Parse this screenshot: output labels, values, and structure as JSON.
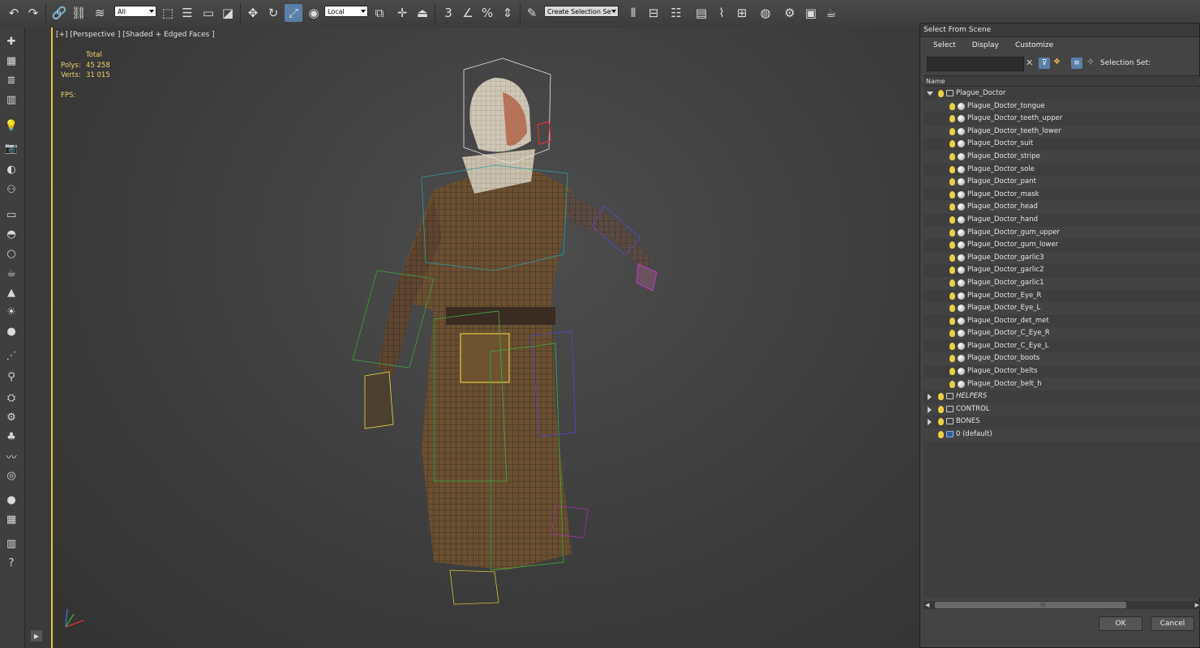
{
  "toolbar": {
    "selection_filter": "All",
    "coord_system": "Local",
    "selection_set_placeholder": "Create Selection Se"
  },
  "viewport": {
    "label": "[+] [Perspective ] [Shaded + Edged Faces ]",
    "stats": {
      "total_label": "Total",
      "polys_label": "Polys:",
      "polys_value": "45 258",
      "verts_label": "Verts:",
      "verts_value": "31 015",
      "fps_label": "FPS:"
    }
  },
  "dialog": {
    "title": "Select From Scene",
    "menu": [
      "Select",
      "Display",
      "Customize"
    ],
    "selection_set_label": "Selection Set:",
    "column_header": "Name",
    "tree": [
      {
        "name": "Plague_Doctor",
        "type": "layer",
        "level": 0,
        "expanded": true
      },
      {
        "name": "Plague_Doctor_tongue",
        "type": "object",
        "level": 1
      },
      {
        "name": "Plague_Doctor_teeth_upper",
        "type": "object",
        "level": 1
      },
      {
        "name": "Plague_Doctor_teeth_lower",
        "type": "object",
        "level": 1
      },
      {
        "name": "Plague_Doctor_suit",
        "type": "object",
        "level": 1
      },
      {
        "name": "Plague_Doctor_stripe",
        "type": "object",
        "level": 1
      },
      {
        "name": "Plague_Doctor_sole",
        "type": "object",
        "level": 1
      },
      {
        "name": "Plague_Doctor_pant",
        "type": "object",
        "level": 1
      },
      {
        "name": "Plague_Doctor_mask",
        "type": "object",
        "level": 1
      },
      {
        "name": "Plague_Doctor_head",
        "type": "object",
        "level": 1
      },
      {
        "name": "Plague_Doctor_hand",
        "type": "object",
        "level": 1
      },
      {
        "name": "Plague_Doctor_gum_upper",
        "type": "object",
        "level": 1
      },
      {
        "name": "Plague_Doctor_gum_lower",
        "type": "object",
        "level": 1
      },
      {
        "name": "Plague_Doctor_garlic3",
        "type": "object",
        "level": 1
      },
      {
        "name": "Plague_Doctor_garlic2",
        "type": "object",
        "level": 1
      },
      {
        "name": "Plague_Doctor_garlic1",
        "type": "object",
        "level": 1
      },
      {
        "name": "Plague_Doctor_Eye_R",
        "type": "object",
        "level": 1
      },
      {
        "name": "Plague_Doctor_Eye_L",
        "type": "object",
        "level": 1
      },
      {
        "name": "Plague_Doctor_det_met",
        "type": "object",
        "level": 1
      },
      {
        "name": "Plague_Doctor_C_Eye_R",
        "type": "object",
        "level": 1
      },
      {
        "name": "Plague_Doctor_C_Eye_L",
        "type": "object",
        "level": 1
      },
      {
        "name": "Plague_Doctor_boots",
        "type": "object",
        "level": 1
      },
      {
        "name": "Plague_Doctor_belts",
        "type": "object",
        "level": 1
      },
      {
        "name": "Plague_Doctor_belt_h",
        "type": "object",
        "level": 1
      },
      {
        "name": "HELPERS",
        "type": "layer",
        "level": 0,
        "expanded": false,
        "italic": true
      },
      {
        "name": "CONTROL",
        "type": "layer",
        "level": 0,
        "expanded": false
      },
      {
        "name": "BONES",
        "type": "layer",
        "level": 0,
        "expanded": false
      },
      {
        "name": "0 (default)",
        "type": "default-layer",
        "level": 0
      }
    ],
    "ok_label": "OK",
    "cancel_label": "Cancel"
  },
  "colors": {
    "viewport_border": "#e7c443",
    "stats_text": "#f1d36c",
    "active_button": "#5a7fa8",
    "bulb": "#e9d046"
  }
}
